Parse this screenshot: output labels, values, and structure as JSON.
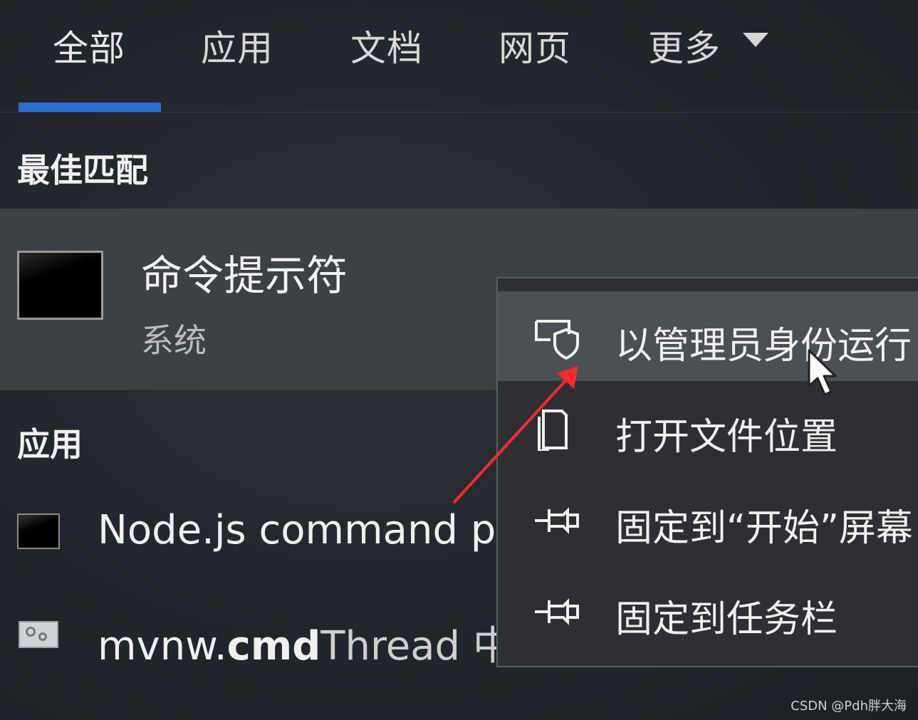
{
  "tabs": [
    {
      "label": "全部",
      "active": true
    },
    {
      "label": "应用"
    },
    {
      "label": "文档"
    },
    {
      "label": "网页"
    },
    {
      "label": "更多"
    }
  ],
  "best_match": {
    "section_title": "最佳匹配",
    "name": "命令提示符",
    "subtitle": "系统",
    "icon": "cmd-icon"
  },
  "apps": {
    "section_title": "应用",
    "items": [
      {
        "label": "Node.js command p",
        "icon": "cmd-icon"
      },
      {
        "label_bold_prefix": "mvnw.",
        "label_bold": "cmd",
        "label_rest": "Thread 中",
        "icon": "script-gear-icon"
      }
    ]
  },
  "context_menu": {
    "items": [
      {
        "label": "以管理员身份运行",
        "icon": "shield-icon",
        "hover": true
      },
      {
        "label": "打开文件位置",
        "icon": "folder-file-icon"
      },
      {
        "label": "固定到“开始”屏幕",
        "icon": "pin-icon"
      },
      {
        "label": "固定到任务栏",
        "icon": "pin-icon"
      }
    ]
  },
  "colors": {
    "accent": "#2f6bd0",
    "annotation_arrow": "#ff2a2a"
  },
  "watermark": "CSDN @Pdh胖大海"
}
